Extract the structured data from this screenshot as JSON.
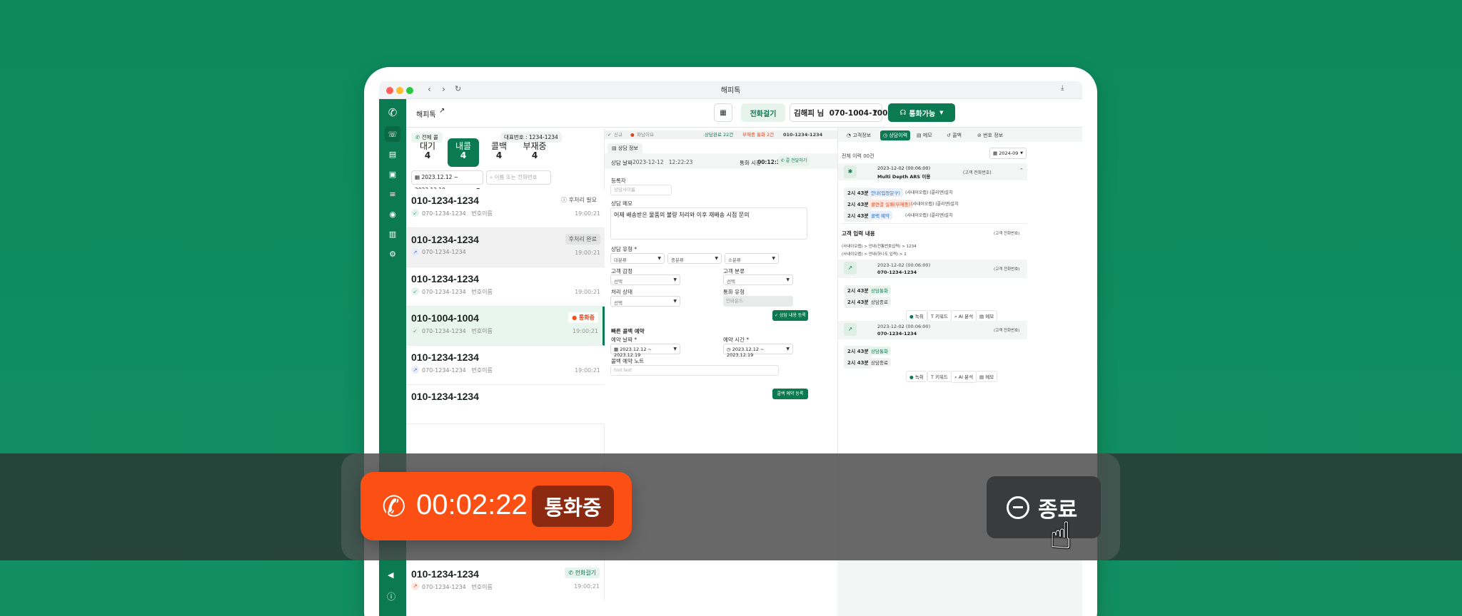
{
  "app": {
    "window_title": "해피톡",
    "brand_label": "해피톡"
  },
  "topbar": {
    "call_button": "전화걸기",
    "agent": "김해피 님  070-1004-1004",
    "status_button": "통화가능"
  },
  "list": {
    "all_call_chip": "전체 콜",
    "rep_number": "대표번호 : 1234-1234",
    "tabs": [
      {
        "label": "대기",
        "count": "4"
      },
      {
        "label": "내콜",
        "count": "4"
      },
      {
        "label": "콜백",
        "count": "4"
      },
      {
        "label": "부재중",
        "count": "4"
      }
    ],
    "date_range": "2023.12.12 ~ 2023.12.19",
    "search_placeholder": "이름 또는 전화번호",
    "items": [
      {
        "number": "010-1234-1234",
        "sub": "070-1234-1234   번호이름",
        "time": "19:00:21",
        "badge": "후처리 필요"
      },
      {
        "number": "010-1234-1234",
        "sub": "070-1234-1234",
        "time": "19:00:21",
        "badge": "후처리 완료"
      },
      {
        "number": "010-1234-1234",
        "sub": "070-1234-1234   번호이름",
        "time": "19:00:21",
        "badge": ""
      },
      {
        "number": "010-1004-1004",
        "sub": "070-1234-1234   번호이름",
        "time": "19:00:21",
        "badge": "통화중"
      },
      {
        "number": "010-1234-1234",
        "sub": "070-1234-1234   번호이름",
        "time": "19:00:21",
        "badge": ""
      },
      {
        "number": "010-1234-1234",
        "sub": "",
        "time": "",
        "badge": ""
      },
      {
        "number": "010-1234-1234",
        "sub": "070-1234-1234   번호이름",
        "time": "19:00:21",
        "badge": "전화걸기"
      }
    ]
  },
  "infobar": {
    "new": "신규",
    "warn": "파남이요",
    "done": "상담완료 22건",
    "missed": "부재중 통화 2건",
    "phone": "010-1234-1234"
  },
  "form": {
    "tab": "상담 정보",
    "date_label": "상담 날짜",
    "date_value": "2023-12-12   12:22:23",
    "duration_label": "통화 시간",
    "duration_value": "00:12:32",
    "transfer_button": "콜 전달하기",
    "registrant_label": "등록자",
    "registrant_placeholder": "상담사이름",
    "memo_label": "상담 메모",
    "memo_text": "어제 배송받은 물품의 불량 처리와 이후 재배송 시점 문의",
    "type_label": "상담 유형 *",
    "type_options": [
      "대분류",
      "중분류",
      "소분류"
    ],
    "emotion_label": "고객 감정",
    "emotion_value": "선택",
    "category_label": "고객 분류",
    "category_value": "선택",
    "process_label": "처리 상태",
    "process_value": "선택",
    "calltype_label": "통화 유형",
    "calltype_value": "인바운드",
    "register_button": "상담 내용 등록",
    "callback_title": "빠른 콜백 예약",
    "reserve_date_label": "예약 날짜 *",
    "reserve_date_value": "2023.12.12 ~ 2023.12.19",
    "reserve_time_label": "예약 시간 *",
    "reserve_time_value": "2023.12.12 ~ 2023.12.19",
    "note_label": "콜백 예약 노트",
    "note_placeholder": "hint text",
    "callback_button": "콜백 예약 등록"
  },
  "history": {
    "tabs": [
      "고객정보",
      "상담이력",
      "메모",
      "콜백",
      "번호 정보"
    ],
    "summary": "전체 이력 00건",
    "month": "2024-09",
    "entries": [
      {
        "date": "2023-12-02 (00:06:00)",
        "title": "Multi Depth ARS 이용",
        "type": "(고객 전화번호)",
        "rows": [
          {
            "t": "2시 43분",
            "pill": "안내(입장문구)",
            "text": "(사내이오랩) (콜리엔)설치"
          },
          {
            "t": "2시 43분",
            "pill": "콜연결 실패(부재중)",
            "text": "(사내이오랩) (콜리엔)설치"
          },
          {
            "t": "2시 43분",
            "pill": "콜백 예약",
            "text": "(사내이오랩) (콜리엔)설치"
          }
        ]
      }
    ],
    "input_title": "고객 입력 내용",
    "input_type": "(고객 전화번호)",
    "input_line1": "(사내이오랩) > 안내(전통번호입력) > 1234",
    "input_line2": "(사내이오랩) > 안내(하나도 입력) > 1",
    "calls": [
      {
        "date": "2023-12-02 (00:06:00)",
        "number": "070-1234-1234",
        "type": "(고객 전화번호)",
        "r1": "상담통화",
        "r2": "상담종료"
      },
      {
        "date": "2023-12-02 (00:06:00)",
        "number": "070-1234-1234",
        "type": "(고객 전화번호)",
        "r1": "상담통화",
        "r2": "상담종료"
      }
    ],
    "row_time": "2시 43분",
    "actions": [
      "녹취",
      "키워드",
      "AI 분석",
      "메모"
    ]
  },
  "call_overlay": {
    "timer": "00:02:22",
    "status": "통화중",
    "end_label": "종료"
  },
  "colors": {
    "background": "#0e8a5f",
    "accent": "#0b7a52",
    "timer": "#fb4f14",
    "end_button": "#3a3b3c"
  }
}
